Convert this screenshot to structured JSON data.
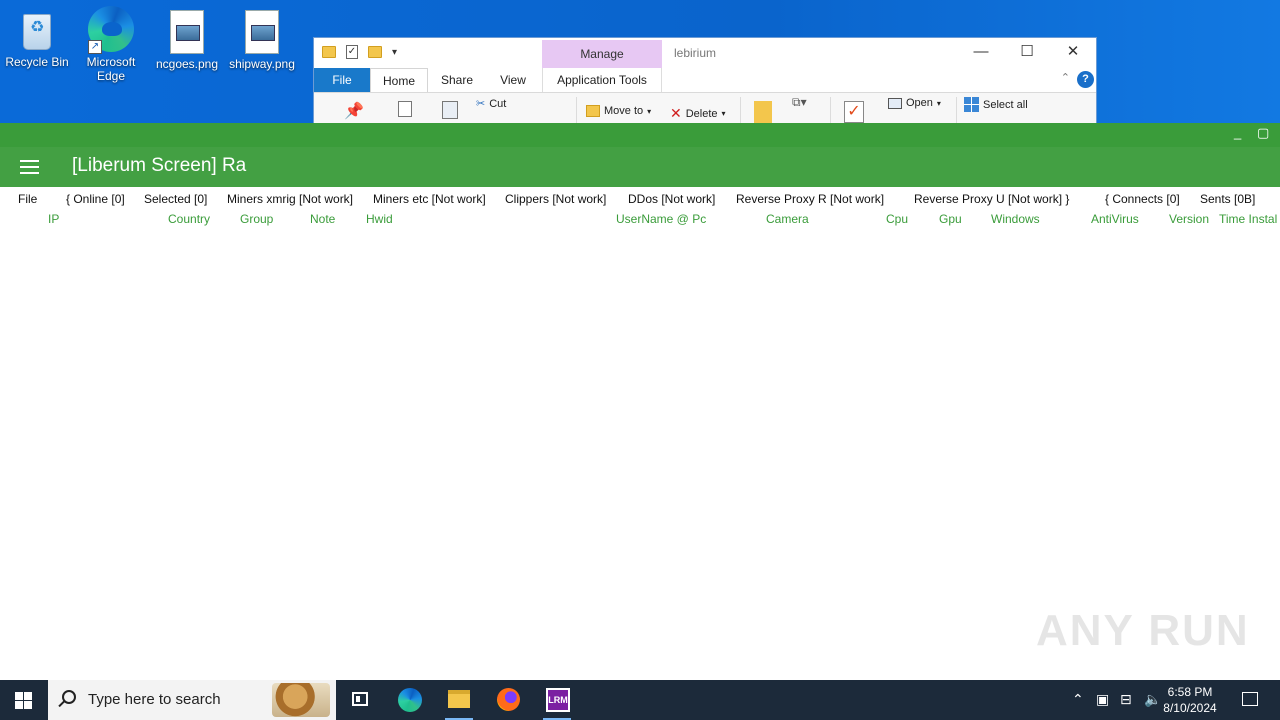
{
  "desktop": {
    "icons": [
      {
        "label": "Recycle Bin"
      },
      {
        "label": "Microsoft Edge"
      },
      {
        "label": "ncgoes.png"
      },
      {
        "label": "shipway.png"
      }
    ]
  },
  "explorer": {
    "contextual_tab": "Manage",
    "window_name": "lebirium",
    "tabs": [
      "File",
      "Home",
      "Share",
      "View",
      "Application Tools"
    ],
    "ribbon": {
      "cut": "Cut",
      "move_to": "Move to",
      "delete": "Delete",
      "open": "Open",
      "select_all": "Select all"
    },
    "controls": {
      "minimize": "—",
      "maximize": "☐",
      "close": "✕",
      "help": "?"
    }
  },
  "app": {
    "title": "[Liberum Screen] Ra",
    "strip_controls": {
      "minimize": "_",
      "maximize": "▢"
    },
    "menu": [
      "File",
      "{ Online [0]",
      "Selected [0]",
      "Miners xmrig [Not work]",
      "Miners etc [Not work]",
      "Clippers [Not work]",
      "DDos [Not work]",
      "Reverse Proxy R [Not work]",
      "Reverse Proxy U [Not work] }",
      "{ Connects [0]",
      "Sents [0B]"
    ],
    "columns": [
      "IP",
      "Country",
      "Group",
      "Note",
      "Hwid",
      "UserName @ Pc",
      "Camera",
      "Cpu",
      "Gpu",
      "Windows",
      "AntiVirus",
      "Version",
      "Time Instal"
    ]
  },
  "watermark": "ANY RUN",
  "taskbar": {
    "search_placeholder": "Type here to search",
    "time": "6:58 PM",
    "date": "8/10/2024"
  },
  "colors": {
    "app_header": "#43a043",
    "app_strip": "#3a9c3a",
    "column_text": "#3a9c3a",
    "taskbar": "#1c2a3a"
  }
}
